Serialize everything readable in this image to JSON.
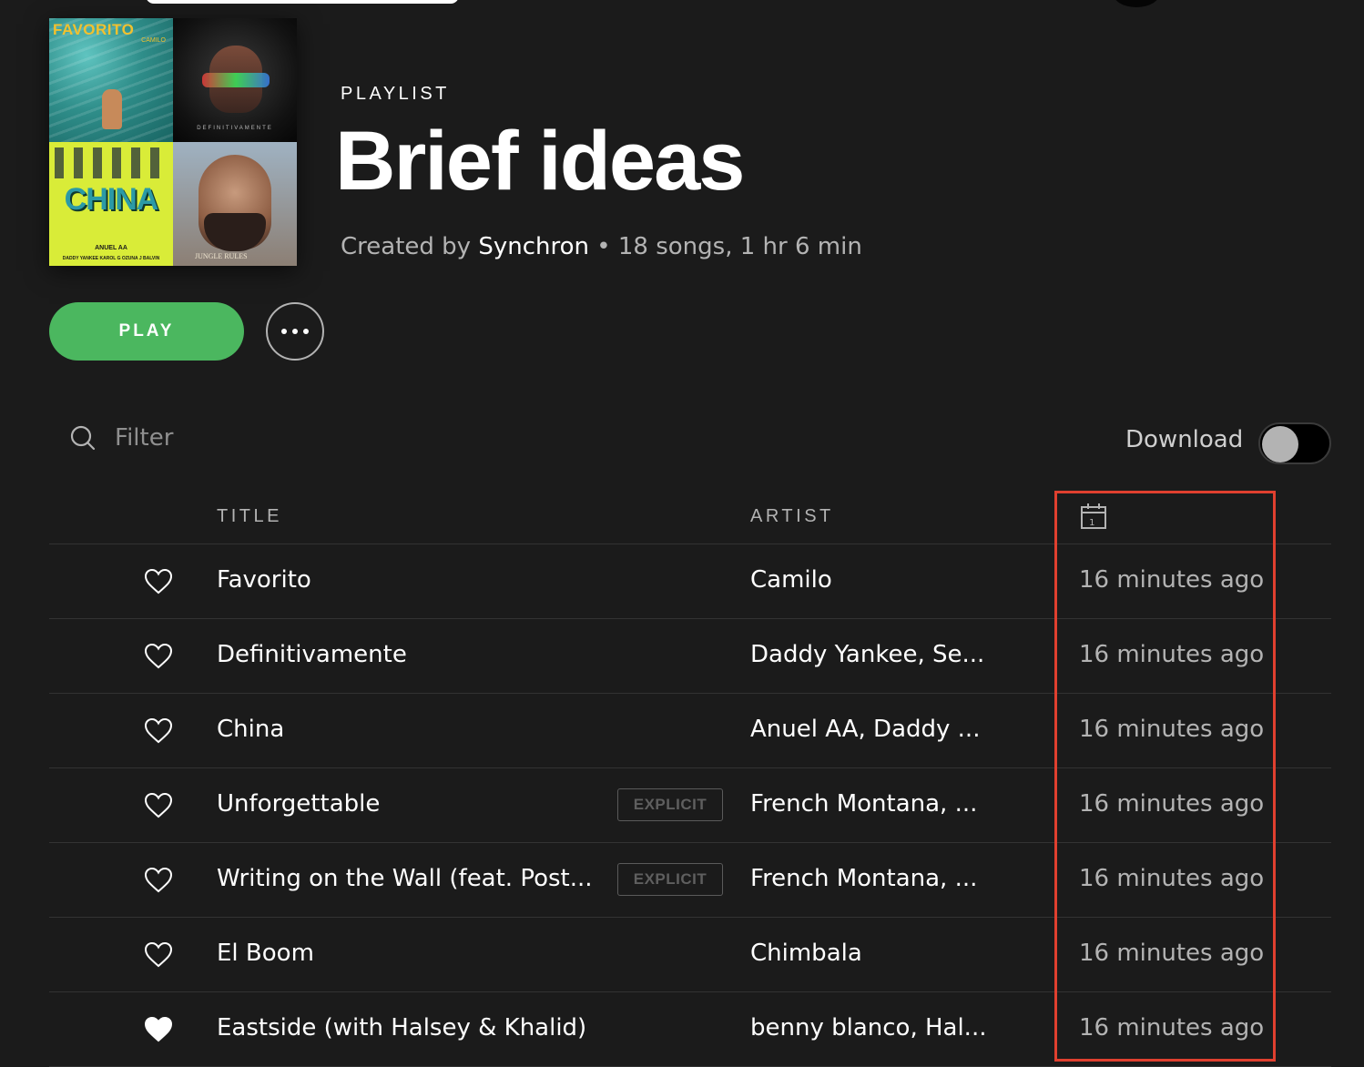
{
  "playlist": {
    "kind": "PLAYLIST",
    "title": "Brief ideas",
    "created_by_prefix": "Created by",
    "owner": "Synchron",
    "separator": " • ",
    "stats": "18 songs, 1 hr 6 min"
  },
  "cover": {
    "tile1_title": "FAVORITO",
    "tile1_sub": "CAMILO",
    "tile2_sub": "DEFINITIVAMENTE",
    "tile3_title": "CHINA",
    "tile3_sub1": "ANUEL AA",
    "tile3_sub2": "DADDY YANKEE  KAROL G  OZUNA  J BALVIN",
    "tile4_sub": "JUNGLE RULES"
  },
  "controls": {
    "play_label": "PLAY",
    "filter_placeholder": "Filter",
    "download_label": "Download",
    "download_enabled": false
  },
  "table": {
    "headers": {
      "title": "TITLE",
      "artist": "ARTIST"
    },
    "rows": [
      {
        "title": "Favorito",
        "artist": "Camilo",
        "added": "16 minutes ago",
        "explicit": false,
        "liked": false
      },
      {
        "title": "Definitivamente",
        "artist": "Daddy Yankee, Se...",
        "added": "16 minutes ago",
        "explicit": false,
        "liked": false
      },
      {
        "title": "China",
        "artist": "Anuel AA, Daddy ...",
        "added": "16 minutes ago",
        "explicit": false,
        "liked": false
      },
      {
        "title": "Unforgettable",
        "artist": "French Montana, ...",
        "added": "16 minutes ago",
        "explicit": true,
        "liked": false
      },
      {
        "title": "Writing on the Wall (feat. Post...",
        "artist": "French Montana, ...",
        "added": "16 minutes ago",
        "explicit": true,
        "liked": false
      },
      {
        "title": "El Boom",
        "artist": "Chimbala",
        "added": "16 minutes ago",
        "explicit": false,
        "liked": false
      },
      {
        "title": "Eastside (with Halsey & Khalid)",
        "artist": "benny blanco, Hal...",
        "added": "16 minutes ago",
        "explicit": false,
        "liked": true
      }
    ],
    "explicit_label": "EXPLICIT"
  },
  "colors": {
    "play_green": "#4bb75f",
    "highlight_red": "#e0402f",
    "background": "#1b1b1b"
  },
  "icons": {
    "search": "search-icon",
    "more": "more-icon",
    "date_added": "calendar-icon",
    "heart_outline": "heart-outline-icon",
    "heart_filled": "heart-filled-icon"
  }
}
